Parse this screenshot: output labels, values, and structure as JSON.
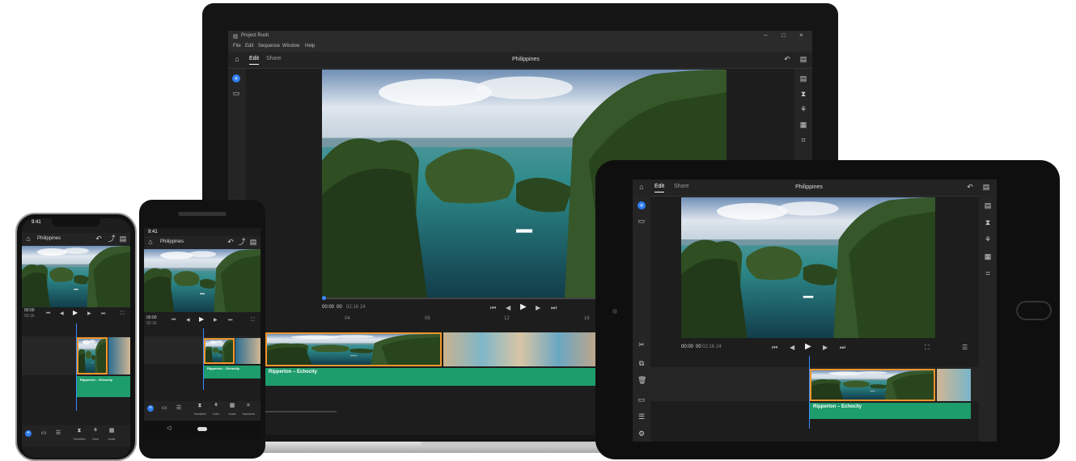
{
  "app": {
    "window_title": "Project Rush",
    "menu": [
      "File",
      "Edit",
      "Sequence",
      "Window",
      "Help"
    ],
    "project_title": "Philippines",
    "tabs": {
      "edit": "Edit",
      "share": "Share"
    }
  },
  "playback": {
    "current_time": "00:00",
    "current_frames": "00",
    "duration": "02:16",
    "duration_frames": "24"
  },
  "timeline": {
    "audio_clip_label": "Ripperton – Echocity",
    "ruler_ticks": [
      "00",
      "04",
      "08",
      "12",
      "16",
      "20",
      "24"
    ]
  },
  "mobile_toolbar": {
    "transitions": "Transition",
    "color": "Color",
    "audio": "Audio",
    "transform": "Transform"
  },
  "phones": {
    "status_time": "9:41"
  },
  "colors": {
    "accent": "#2d7cf0",
    "selection": "#f0962c",
    "audio": "#1d9c6c",
    "playhead": "#3a8bff",
    "panel_bg": "#1d1d1d"
  },
  "icons": {
    "home": "home-icon",
    "undo": "undo-icon",
    "comment": "comment-icon",
    "add": "add-icon",
    "media": "media-icon",
    "layout": "layout-icon",
    "transitions": "transition-icon",
    "color": "color-icon",
    "audio": "audio-icon",
    "transform": "transform-icon"
  }
}
